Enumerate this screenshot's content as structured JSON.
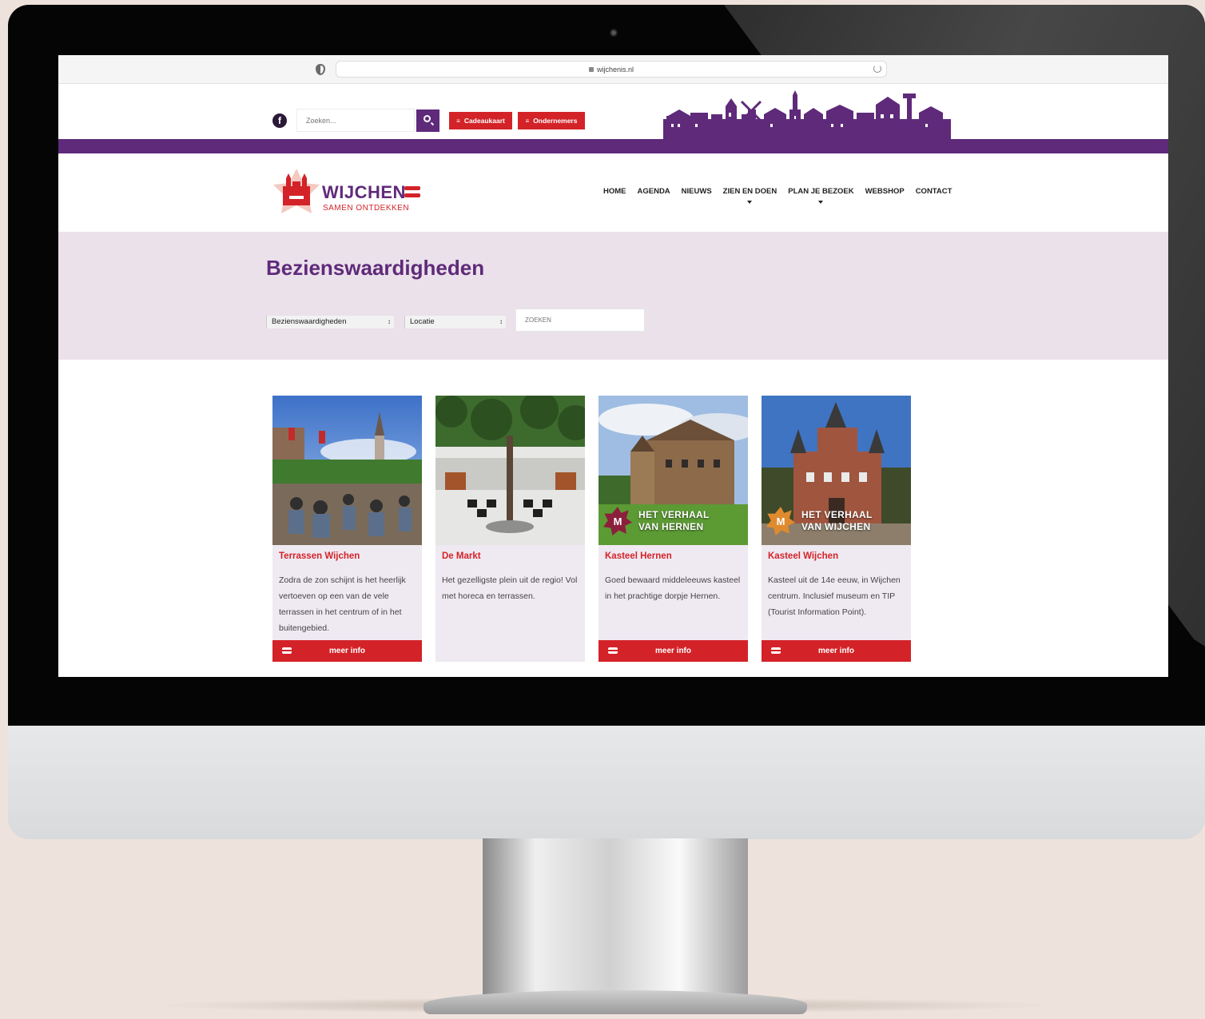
{
  "browser": {
    "url": "wijchenis.nl"
  },
  "topbar": {
    "search_placeholder": "Zoeken...",
    "cadeaukaart_label": "Cadeaukaart",
    "ondernemers_label": "Ondernemers",
    "bars_glyph": "≡"
  },
  "logo": {
    "word": "WIJCHEN",
    "tagline": "SAMEN ONTDEKKEN"
  },
  "nav": {
    "home": "HOME",
    "agenda": "AGENDA",
    "nieuws": "NIEUWS",
    "zien": "ZIEN EN DOEN",
    "plan": "PLAN JE BEZOEK",
    "webshop": "WEBSHOP",
    "contact": "CONTACT"
  },
  "hero": {
    "title": "Bezienswaardigheden",
    "category_select": "Bezienswaardigheden",
    "location_select": "Locatie",
    "search_placeholder": "ZOEKEN",
    "select_arrows": "↕"
  },
  "cards": [
    {
      "title": "Terrassen Wijchen",
      "text": "Zodra de zon schijnt is het heerlijk vertoeven op een van de vele terrassen in het centrum of in het buitengebied.",
      "button": "meer info",
      "badge": ""
    },
    {
      "title": "De Markt",
      "text": "Het gezelligste plein uit de regio! Vol met horeca en terrassen.",
      "button": "",
      "badge": ""
    },
    {
      "title": "Kasteel Hernen",
      "text": "Goed bewaard middeleeuws kasteel in het prachtige dorpje Hernen.",
      "button": "meer info",
      "badge_line1": "HET VERHAAL",
      "badge_line2": "VAN HERNEN",
      "badge_color": "#8b1f3c"
    },
    {
      "title": "Kasteel Wijchen",
      "text": "Kasteel uit de 14e eeuw, in Wijchen centrum. Inclusief museum en TIP (Tourist Information Point).",
      "button": "meer info",
      "badge_line1": "HET VERHAAL",
      "badge_line2": "VAN WIJCHEN",
      "badge_color": "#e08a2e"
    }
  ],
  "colors": {
    "brand_purple": "#5f2a7a",
    "brand_red": "#d32328",
    "hero_bg": "#eae1ea",
    "card_bg": "#efe9f1"
  }
}
